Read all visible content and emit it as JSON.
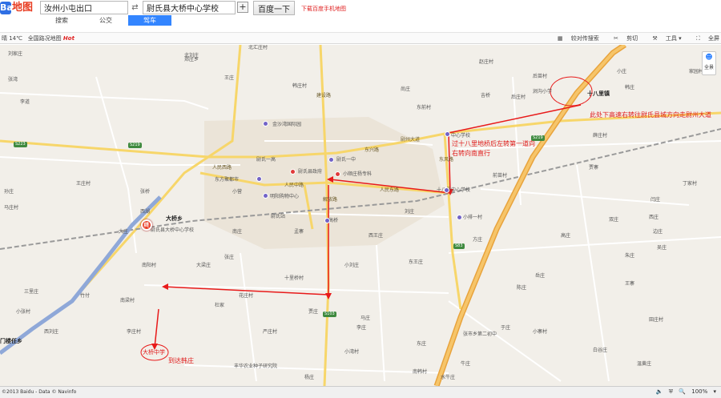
{
  "header": {
    "logo_paw": "Bai",
    "logo_text": "地图",
    "start_value": "汝州小屯出口",
    "end_value": "尉氏县大桥中心学校",
    "swap_icon": "swap-icon",
    "add_waypoint": "+",
    "search_button": "百度一下",
    "download_link": "下载百度手机地图",
    "tabs": [
      "搜索",
      "公交",
      "驾车"
    ],
    "active_tab": "驾车"
  },
  "infobar": {
    "weather": "晴 14℃",
    "promo": "全国路况地图",
    "promo_hot": "Hot",
    "tools": [
      "较对传搜索",
      "剪切",
      "工具",
      "全屏"
    ]
  },
  "map": {
    "towns": [
      "尉氏县",
      "大桥乡",
      "门楼任乡",
      "十八里镇"
    ],
    "labels": {
      "haozhuang": "郑庄乡",
      "zhangqiao": "张桥",
      "dazhuang": "大庄",
      "liujiazhuang": "刘家庄",
      "beiliuzhuang": "北刘庄",
      "beiqizhuang": "北汇庄村",
      "wangzhuang": "王庄",
      "zhangwan": "张湾",
      "houmiao": "后苗村",
      "hanjiazhuang": "韩庄村",
      "nanmiao": "南苗村",
      "lidao": "李道",
      "dongqian": "东前村",
      "shangzhuang": "尚庄",
      "jinsha": "金沙湾国际园",
      "weishi_yizhong": "尉氏一中",
      "weishi_gov": "尉氏县政府",
      "xiaoshou": "小顺庄杨专科",
      "weishi_xianzhengfu": "尉氏一高",
      "dongfang": "东方聚都市",
      "xiaoyin": "小营",
      "mingyang": "明阳购物中心",
      "weishi_zhan": "尉氏站",
      "xianzhong": "县中学",
      "dadou": "大豆",
      "weishi_jiguan": "尉氏县大桥中心学校",
      "xihu": "西湖",
      "nanzhuang": "南庄",
      "mengzhai": "孟寨",
      "nanyang": "南阳村",
      "xiwangzhuang": "西王庄",
      "shiliqiao": "十里桥村",
      "daliangzhuang": "大梁庄",
      "zhangzhuang": "张庄",
      "nanliang": "南梁村",
      "gaoqiao": "高桥",
      "dongwangzhuang": "东王庄",
      "xiaoliuzhuang": "小刘庄",
      "liuzhuang": "刘庄",
      "qianmiao": "前苗村",
      "zhaozhuang": "赵庄村",
      "houzhuang": "后庄村",
      "jiangou": "涧沟小学",
      "jiqiao": "吉桥",
      "hanzhuang": "韩庄",
      "xiaozhuang": "小庄",
      "jiayuan": "家园村",
      "dingzhuang": "丁家村",
      "xuezhuang": "薛庄村",
      "jiazhai": "贾寨",
      "zhongxin": "中心学校",
      "shibali_ps": "十八里中心学校",
      "xiaopaiyi": "小排一村",
      "fangzhuang": "方庄",
      "yuezhuang": "岳庄",
      "chenzhuang": "陈庄",
      "xizhuang": "西庄",
      "yanzhuang": "闫庄",
      "bianzhuang": "边庄",
      "wuzhuang": "吴庄",
      "wangzhai": "王寨",
      "zhuzhuang": "朱庄",
      "shuangzhuang": "双庄",
      "gaozhuang": "高庄",
      "yuzhuang": "于庄",
      "zhangqiaoxiang": "张市乡第二初中",
      "huazhuang": "花庄村",
      "dujia": "杜家",
      "yanzhuang2": "严庄村",
      "jiazhuang": "贾庄",
      "fengzhuang": "丰华农业种子研究院",
      "xiaowan": "小湾村",
      "nanhan": "南韩村",
      "lizhuang": "李庄",
      "mazhuang": "马庄",
      "yangzhuang": "杨庄",
      "xiaozhai": "小寨村",
      "tianzhuang": "田庄村",
      "wenhuangzhuang": "温黄庄",
      "baiguzhuang": "白谷庄",
      "dongzhuang": "东庄",
      "niuzhuang": "牛庄",
      "shuiniuzhuang": "水牛庄",
      "sanlizhuang": "三里庄",
      "zhufu": "竹付",
      "xiaozhang": "小张村",
      "xiliuzhuang": "西刘庄",
      "lizhuang2": "李庄村",
      "mazhuang2": "马庄村",
      "sunzhuang": "孙庄",
      "wangzhuang2": "王庄村"
    },
    "roads": {
      "renmin_west": "人民西路",
      "renmin_middle": "人民中路",
      "renmin_east": "人民东路",
      "weishi_avenue": "尉州大道",
      "jianshe": "建设路",
      "dongfeng": "东风路",
      "jiefang": "解放路",
      "dongxing": "东兴路"
    },
    "shields": [
      "S223",
      "S103",
      "S219",
      "S83",
      "S219"
    ],
    "notes": {
      "exit_note": "此处下高速右转往尉氏县城方向走尉州大道",
      "mid_note": "过十八里地桥后左转第一道向右转向南直行",
      "town_note": "大桥中学",
      "dest_note": "到达韩庄"
    },
    "dest_marker": "终",
    "fullview_button": "全景"
  },
  "status": {
    "copyright": "©2013 Baidu - Data © Navinfo",
    "zoom": "100%"
  }
}
